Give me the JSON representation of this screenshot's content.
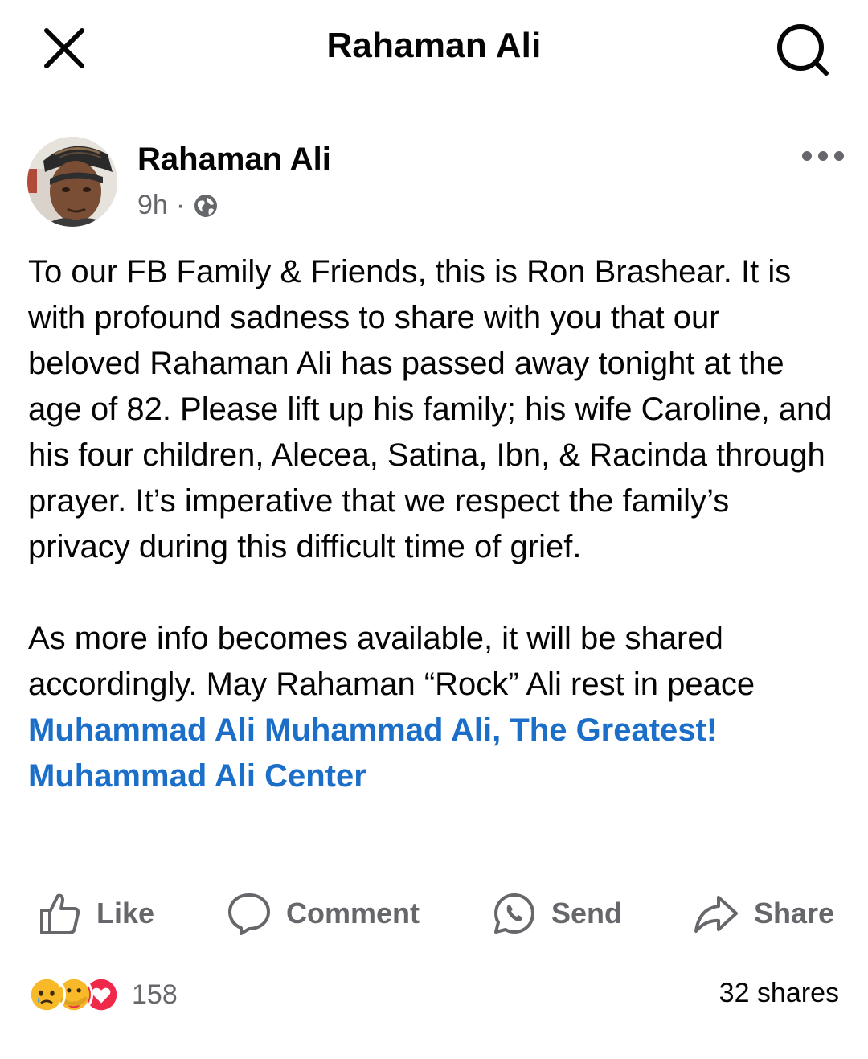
{
  "topbar": {
    "title": "Rahaman Ali",
    "close_icon": "close-icon",
    "search_icon": "search-icon"
  },
  "post": {
    "author": "Rahaman Ali",
    "time": "9h",
    "separator": "·",
    "audience_icon": "globe-icon",
    "more_icon": "more-options-icon",
    "paragraph1": "To our FB Family & Friends, this is Ron Brashear. It is with profound sadness to share with you that our beloved Rahaman Ali has passed away tonight at the age of 82.  Please lift up his family; his wife Caroline, and his four children, Alecea, Satina, Ibn, & Racinda through prayer.  It’s imperative that we respect the family’s privacy during this difficult time of grief.",
    "paragraph2_text": "As more info becomes available, it will be shared accordingly.  May Rahaman “Rock” Ali rest in peace ",
    "mention1": "Muhammad Ali",
    "mention2": "Muhammad Ali, The Greatest!",
    "mention3": "Muhammad Ali Center"
  },
  "actions": {
    "like": "Like",
    "comment": "Comment",
    "send": "Send",
    "share": "Share"
  },
  "footer": {
    "reaction_icons": [
      "sad-reaction-icon",
      "care-reaction-icon",
      "love-reaction-icon"
    ],
    "reaction_count": "158",
    "shares": "32 shares"
  },
  "colors": {
    "link": "#1b6fc9",
    "secondary_text": "#65676b",
    "love": "#f02849",
    "reaction_yellow": "#f7b928"
  }
}
